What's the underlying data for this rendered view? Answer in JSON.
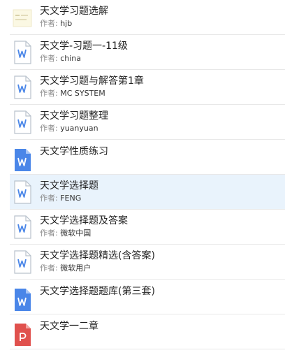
{
  "author_prefix": "作者: ",
  "colors": {
    "doc_blue": "#4a86e8",
    "doc_outline": "#b9c2cc",
    "pdf_red": "#e0514d",
    "selected_bg": "#e9f3fc"
  },
  "items": [
    {
      "title": "天文学习题选解",
      "author": "hjb",
      "icon": "image-thumbnail-icon"
    },
    {
      "title": "天文学-习题一-11级",
      "author": "china",
      "icon": "word-doc-outline-icon"
    },
    {
      "title": "天文学习题与解答第1章",
      "author": "MC SYSTEM",
      "icon": "word-doc-outline-icon"
    },
    {
      "title": "天文学习题整理",
      "author": "yuanyuan",
      "icon": "word-doc-outline-icon"
    },
    {
      "title": "天文学性质练习",
      "author": "",
      "icon": "word-doc-blue-icon"
    },
    {
      "title": "天文学选择题",
      "author": "FENG",
      "icon": "word-doc-outline-icon",
      "selected": true
    },
    {
      "title": "天文学选择题及答案",
      "author": "微软中国",
      "icon": "word-doc-outline-icon"
    },
    {
      "title": "天文学选择题精选(含答案)",
      "author": "微软用户",
      "icon": "word-doc-outline-icon"
    },
    {
      "title": "天文学选择题题库(第三套)",
      "author": "",
      "icon": "word-doc-blue-icon"
    },
    {
      "title": "天文学一二章",
      "author": "",
      "icon": "pdf-doc-icon"
    }
  ]
}
